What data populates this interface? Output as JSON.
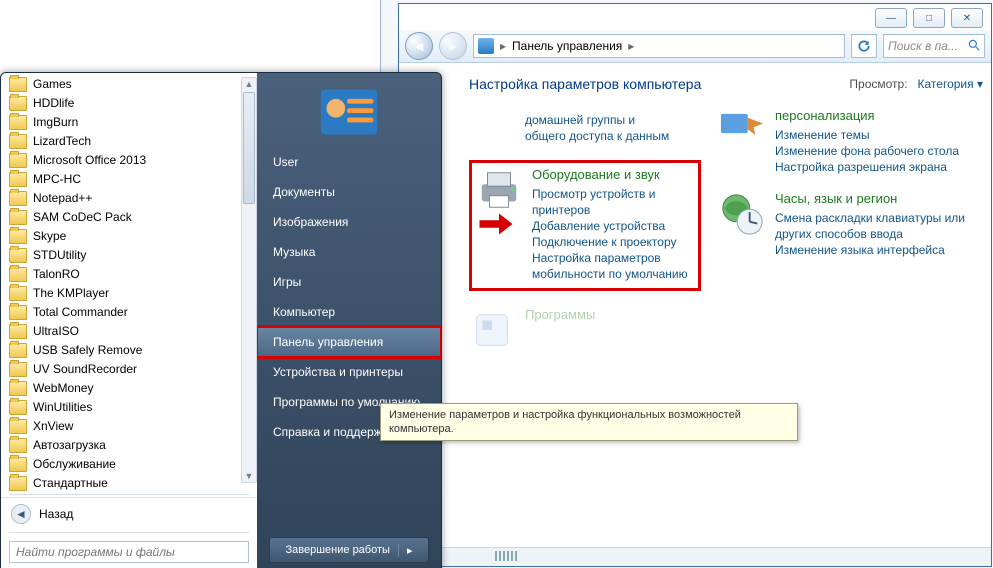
{
  "cp": {
    "title_buttons": {
      "min": "—",
      "max": "□",
      "close": "✕"
    },
    "breadcrumb": {
      "root": "Панель управления",
      "sep": "▸"
    },
    "refresh": "↻",
    "search_placeholder": "Поиск в па...",
    "heading": "Настройка параметров компьютера",
    "view_label": "Просмотр:",
    "view_value": "Категория ▾",
    "left_partial": {
      "l1": "домашней группы и",
      "l2": "общего доступа к данным"
    },
    "hardware": {
      "title": "Оборудование и звук",
      "links": [
        "Просмотр устройств и принтеров",
        "Добавление устройства",
        "Подключение к проектору",
        "Настройка параметров мобильности по умолчанию"
      ]
    },
    "programs_title": "Программы",
    "right_partial_title": "персонализация",
    "appearance_links": [
      "Изменение темы",
      "Изменение фона рабочего стола",
      "Настройка разрешения экрана"
    ],
    "clock": {
      "title": "Часы, язык и регион",
      "links": [
        "Смена раскладки клавиатуры или других способов ввода",
        "Изменение языка интерфейса"
      ]
    }
  },
  "sm": {
    "folders": [
      "Games",
      "HDDlife",
      "ImgBurn",
      "LizardTech",
      "Microsoft Office 2013",
      "MPC-HC",
      "Notepad++",
      "SAM CoDeC Pack",
      "Skype",
      "STDUtility",
      "TalonRO",
      "The KMPlayer",
      "Total Commander",
      "UltraISO",
      "USB Safely Remove",
      "UV SoundRecorder",
      "WebMoney",
      "WinUtilities",
      "XnView",
      "Автозагрузка",
      "Обслуживание",
      "Стандартные"
    ],
    "back": "Назад",
    "search_placeholder": "Найти программы и файлы",
    "right_items": [
      "User",
      "Документы",
      "Изображения",
      "Музыка",
      "Игры",
      "Компьютер",
      "Панель управления",
      "Устройства и принтеры",
      "Программы по умолчанию",
      "Справка и поддержка"
    ],
    "highlight_index": 6,
    "shutdown": "Завершение работы"
  },
  "tooltip": "Изменение параметров и настройка функциональных возможностей компьютера."
}
